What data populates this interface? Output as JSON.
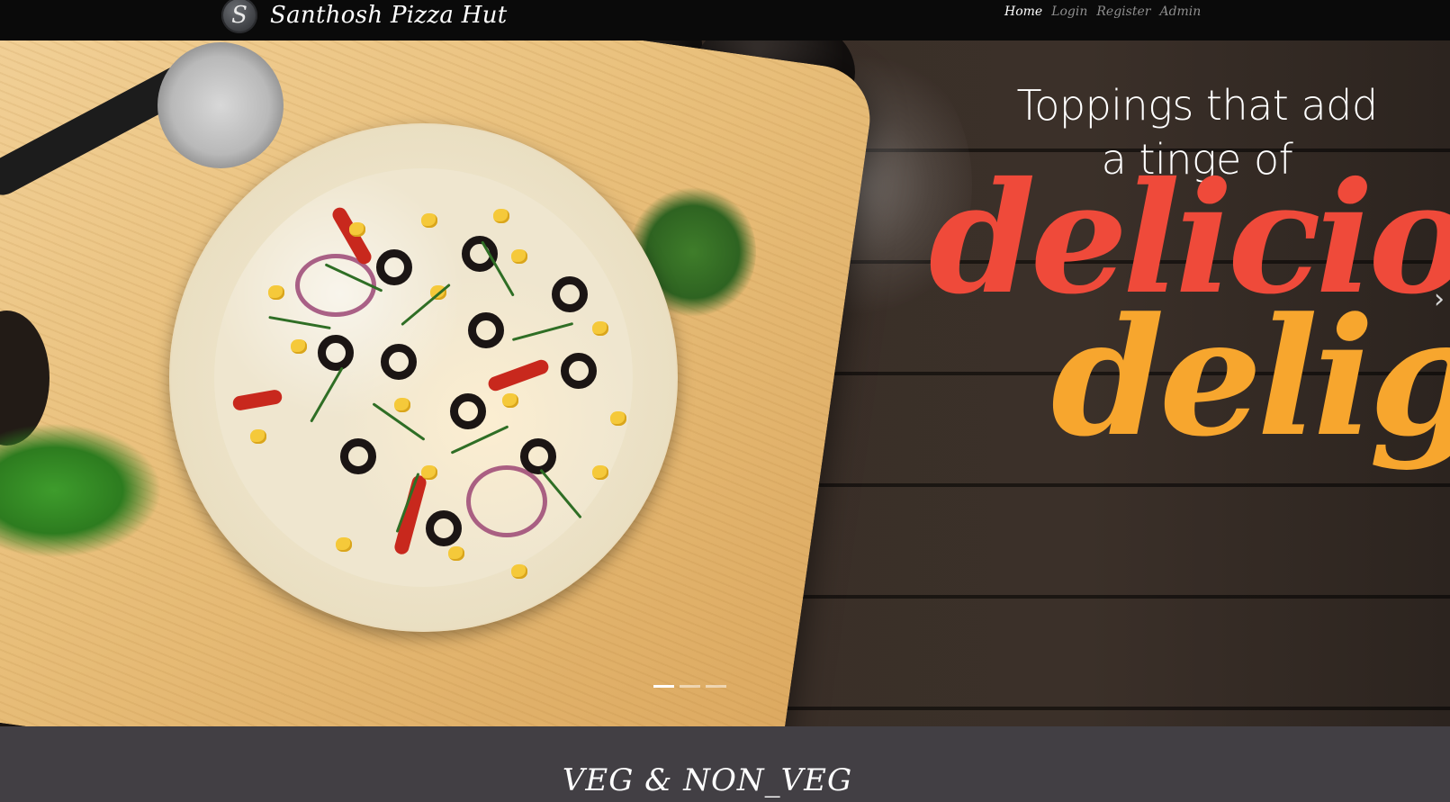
{
  "navbar": {
    "logo_letter": "S",
    "brand": "Santhosh Pizza Hut",
    "links": [
      "Home",
      "Login",
      "Register",
      "Admin"
    ]
  },
  "hero": {
    "headline_line1": "Toppings that add",
    "headline_line2": "a tinge of",
    "script_word1": "delicious",
    "script_word2": "delight",
    "next_icon": "›"
  },
  "section": {
    "title": "VEG & NON_VEG"
  }
}
